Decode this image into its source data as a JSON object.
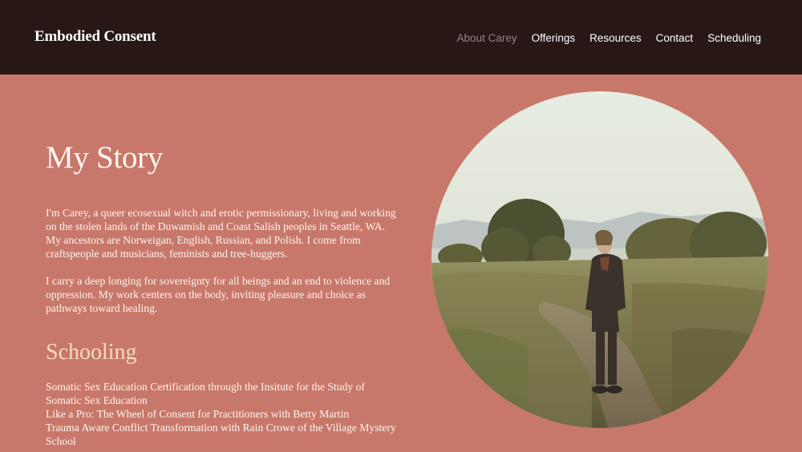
{
  "header": {
    "brand": "Embodied Consent",
    "nav": [
      {
        "label": "About Carey",
        "active": true
      },
      {
        "label": "Offerings",
        "active": false
      },
      {
        "label": "Resources",
        "active": false
      },
      {
        "label": "Contact",
        "active": false
      },
      {
        "label": "Scheduling",
        "active": false
      }
    ]
  },
  "main": {
    "title": "My Story",
    "paragraphs": [
      "I'm Carey, a queer ecosexual witch and erotic permissionary, living and working on the stolen lands of the Duwamish and Coast Salish peoples in Seattle, WA. My ancestors are Norweigan, English, Russian, and Polish. I come from craftspeople and musicians, feminists and tree-huggers.",
      "I carry a deep longing for sovereignty for all beings and an end to violence and oppression. My work centers on the body, inviting pleasure and choice as pathways toward healing."
    ],
    "schooling_heading": "Schooling",
    "schooling": [
      "Somatic Sex Education Certification through the Insitute for the Study of Somatic Sex Education",
      "Like a Pro: The Wheel of Consent for Practitioners with Betty Martin",
      "Trauma Aware Conflict Transformation with Rain Crowe of the Village Mystery School"
    ]
  },
  "colors": {
    "header_bg": "#271816",
    "page_bg": "#c8786a",
    "heading_accent": "#f6ddb9",
    "nav_active": "#8e8683"
  }
}
